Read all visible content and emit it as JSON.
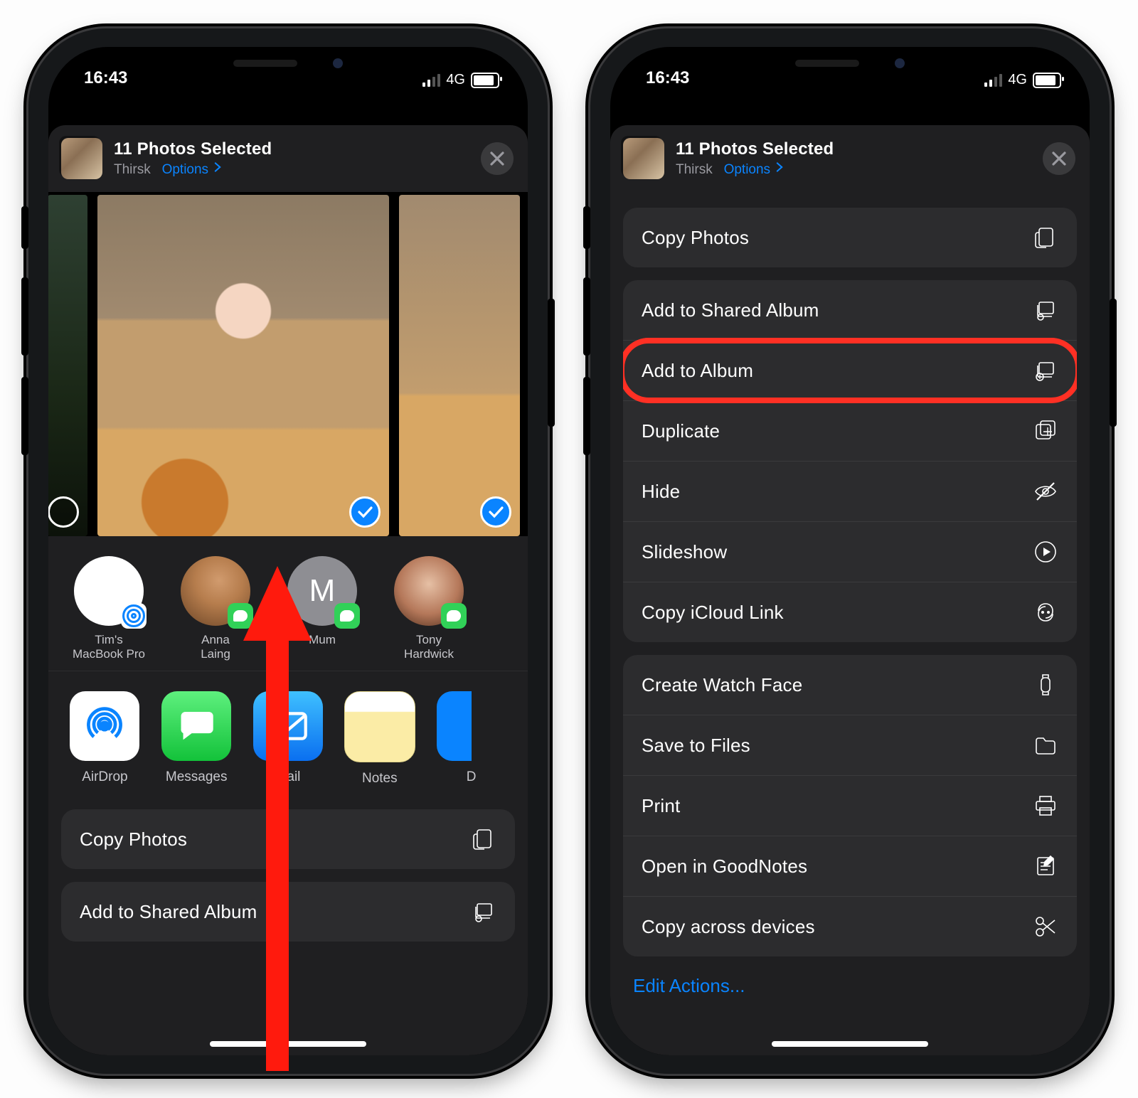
{
  "status": {
    "time": "16:43",
    "net": "4G"
  },
  "header": {
    "title": "11 Photos Selected",
    "location": "Thirsk",
    "options_label": "Options"
  },
  "contacts": [
    {
      "name": "Tim's MacBook Pro",
      "avatar": "laptop",
      "badge": "airdrop"
    },
    {
      "name": "Anna Laing",
      "avatar": "anna",
      "badge": "msg",
      "initial": ""
    },
    {
      "name": "Mum",
      "avatar": "mum",
      "badge": "msg",
      "initial": "M"
    },
    {
      "name": "Tony Hardwick",
      "avatar": "tony",
      "badge": "msg",
      "initial": ""
    }
  ],
  "apps": [
    {
      "name": "AirDrop",
      "kind": "airdrop"
    },
    {
      "name": "Messages",
      "kind": "messages"
    },
    {
      "name": "Mail",
      "kind": "mail"
    },
    {
      "name": "Notes",
      "kind": "notes"
    },
    {
      "name": "D",
      "kind": "partial"
    }
  ],
  "actions_left": [
    {
      "label": "Copy Photos",
      "icon": "copy"
    },
    {
      "label": "Add to Shared Album",
      "icon": "shared"
    }
  ],
  "actions_right": [
    [
      {
        "label": "Copy Photos",
        "icon": "copy"
      }
    ],
    [
      {
        "label": "Add to Shared Album",
        "icon": "shared"
      },
      {
        "label": "Add to Album",
        "icon": "album",
        "highlight": true
      },
      {
        "label": "Duplicate",
        "icon": "dup"
      },
      {
        "label": "Hide",
        "icon": "hide"
      },
      {
        "label": "Slideshow",
        "icon": "play"
      },
      {
        "label": "Copy iCloud Link",
        "icon": "link"
      }
    ],
    [
      {
        "label": "Create Watch Face",
        "icon": "watch"
      },
      {
        "label": "Save to Files",
        "icon": "folder"
      },
      {
        "label": "Print",
        "icon": "print"
      },
      {
        "label": "Open in GoodNotes",
        "icon": "note"
      },
      {
        "label": "Copy across devices",
        "icon": "cut"
      }
    ]
  ],
  "edit_actions_label": "Edit Actions..."
}
